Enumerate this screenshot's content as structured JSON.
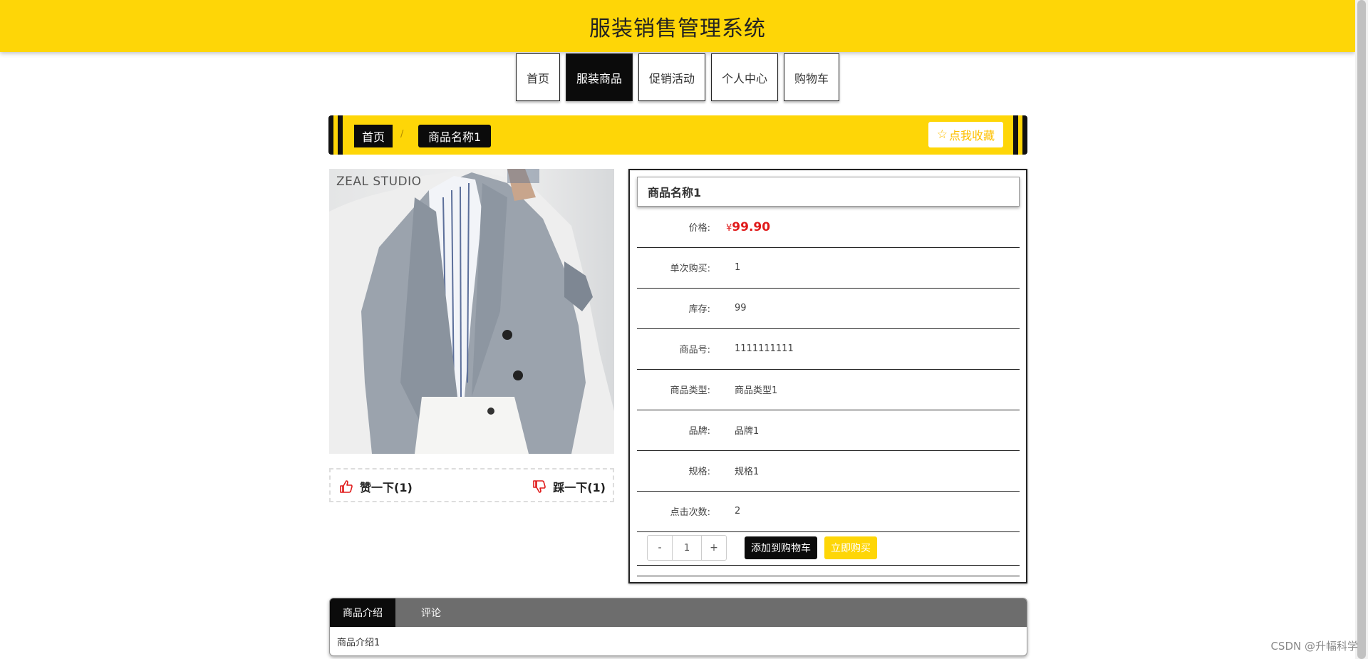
{
  "header": {
    "title": "服装销售管理系统"
  },
  "nav": {
    "items": [
      "首页",
      "服装商品",
      "促销活动",
      "个人中心",
      "购物车"
    ],
    "active_index": 1
  },
  "breadcrumb": {
    "home": "首页",
    "separator": "/",
    "current": "商品名称1",
    "favorite_label": "点我收藏",
    "favorite_icon": "star-outline-icon"
  },
  "product": {
    "image_text": "ZEAL STUDIO",
    "name": "商品名称1",
    "price_label": "价格:",
    "price_currency": "¥",
    "price_value": "99.90",
    "fields": [
      {
        "label": "单次购买:",
        "value": "1"
      },
      {
        "label": "库存:",
        "value": "99"
      },
      {
        "label": "商品号:",
        "value": "1111111111"
      },
      {
        "label": "商品类型:",
        "value": "商品类型1"
      },
      {
        "label": "品牌:",
        "value": "品牌1"
      },
      {
        "label": "规格:",
        "value": "规格1"
      },
      {
        "label": "点击次数:",
        "value": "2"
      }
    ],
    "stepper": {
      "minus": "-",
      "value": "1",
      "plus": "+"
    },
    "add_to_cart_label": "添加到购物车",
    "buy_now_label": "立即购买"
  },
  "votes": {
    "like": "赞一下(1)",
    "dislike": "踩一下(1)"
  },
  "tabs": {
    "items": [
      "商品介绍",
      "评论"
    ],
    "active_index": 0,
    "content": "商品介绍1"
  },
  "watermark": "CSDN @升幅科学",
  "colors": {
    "brand_yellow": "#fed607",
    "dark": "#0b0b0b",
    "price_red": "#e01a1a"
  }
}
